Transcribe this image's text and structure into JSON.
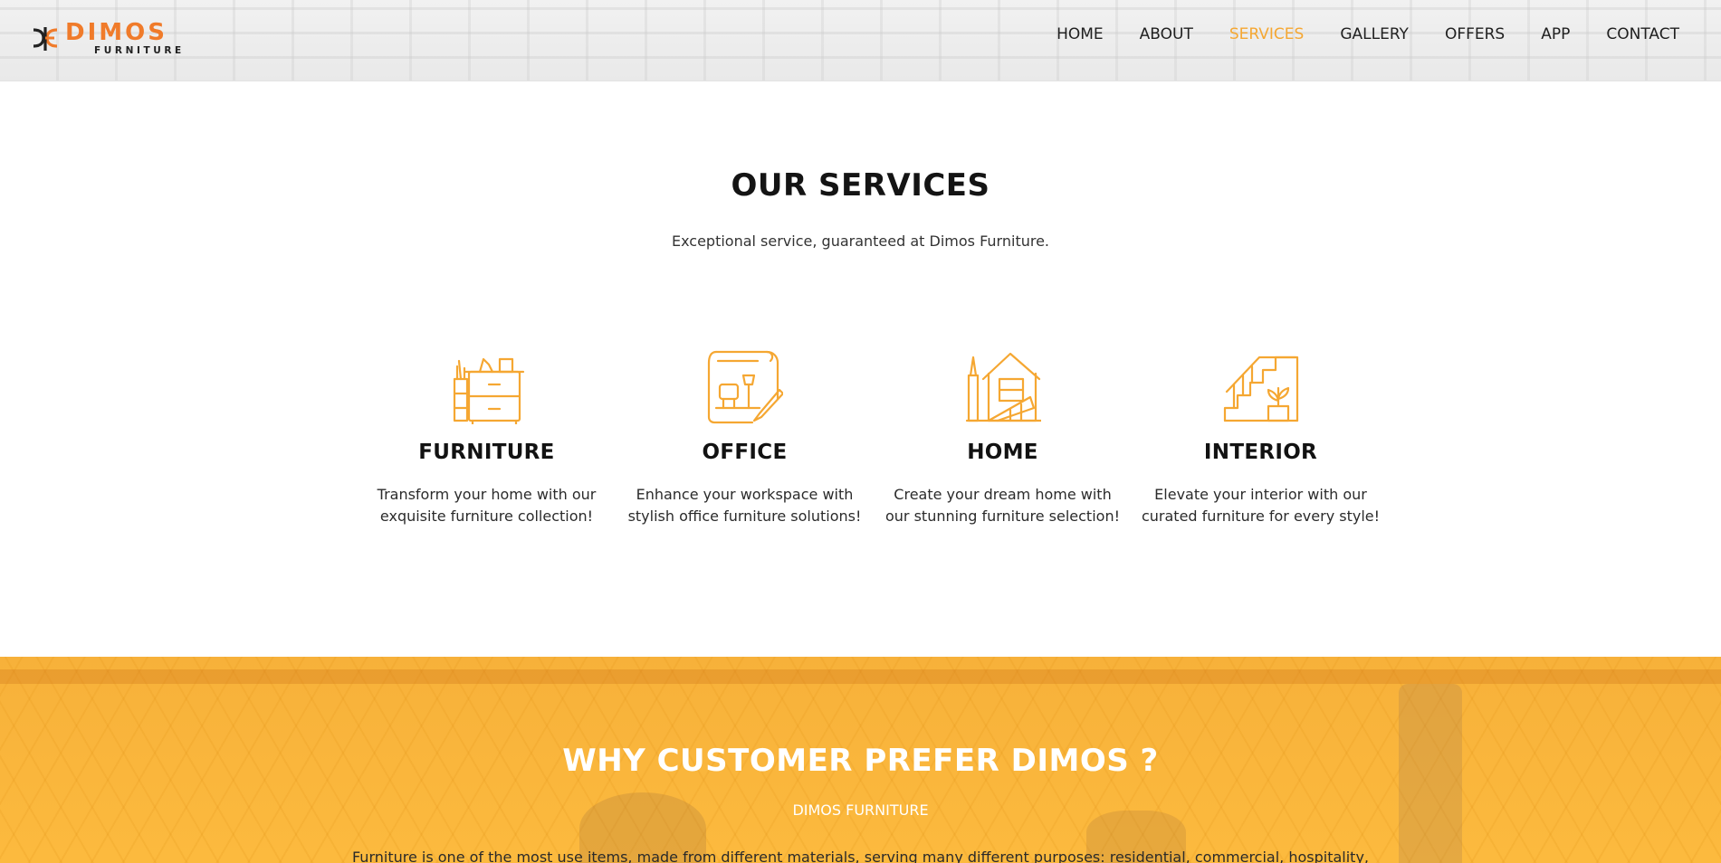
{
  "brand": {
    "name": "DIMOS",
    "sub": "FURNITURE",
    "accent": "#f5a732",
    "logo_color": "#f07b2a"
  },
  "nav": {
    "items": [
      {
        "label": "HOME"
      },
      {
        "label": "ABOUT"
      },
      {
        "label": "SERVICES",
        "active": true
      },
      {
        "label": "GALLERY"
      },
      {
        "label": "OFFERS"
      },
      {
        "label": "APP"
      },
      {
        "label": "CONTACT"
      }
    ]
  },
  "services": {
    "title": "OUR SERVICES",
    "subtitle": "Exceptional service, guaranteed at Dimos Furniture.",
    "cards": [
      {
        "icon": "drawer-cabinet-icon",
        "title": "FURNITURE",
        "line1": "Transform your home with our",
        "line2": "exquisite furniture collection!"
      },
      {
        "icon": "office-blueprint-icon",
        "title": "OFFICE",
        "line1": "Enhance your workspace with",
        "line2": "stylish office furniture solutions!"
      },
      {
        "icon": "house-paint-icon",
        "title": "HOME",
        "line1": "Create your dream home with",
        "line2": "our stunning furniture selection!"
      },
      {
        "icon": "staircase-plant-icon",
        "title": "INTERIOR",
        "line1": "Elevate your interior with our",
        "line2": "curated furniture for every style!"
      }
    ]
  },
  "why": {
    "title_prefix": "WHY CUSTOMER PREFER ",
    "title_brand": "DIMOS ?",
    "subtitle": "DIMOS FURNITURE",
    "body": "Furniture is one of the most use items, made from different materials, serving many different purposes: residential, commercial, hospitality,",
    "background": "#fcba3e"
  }
}
